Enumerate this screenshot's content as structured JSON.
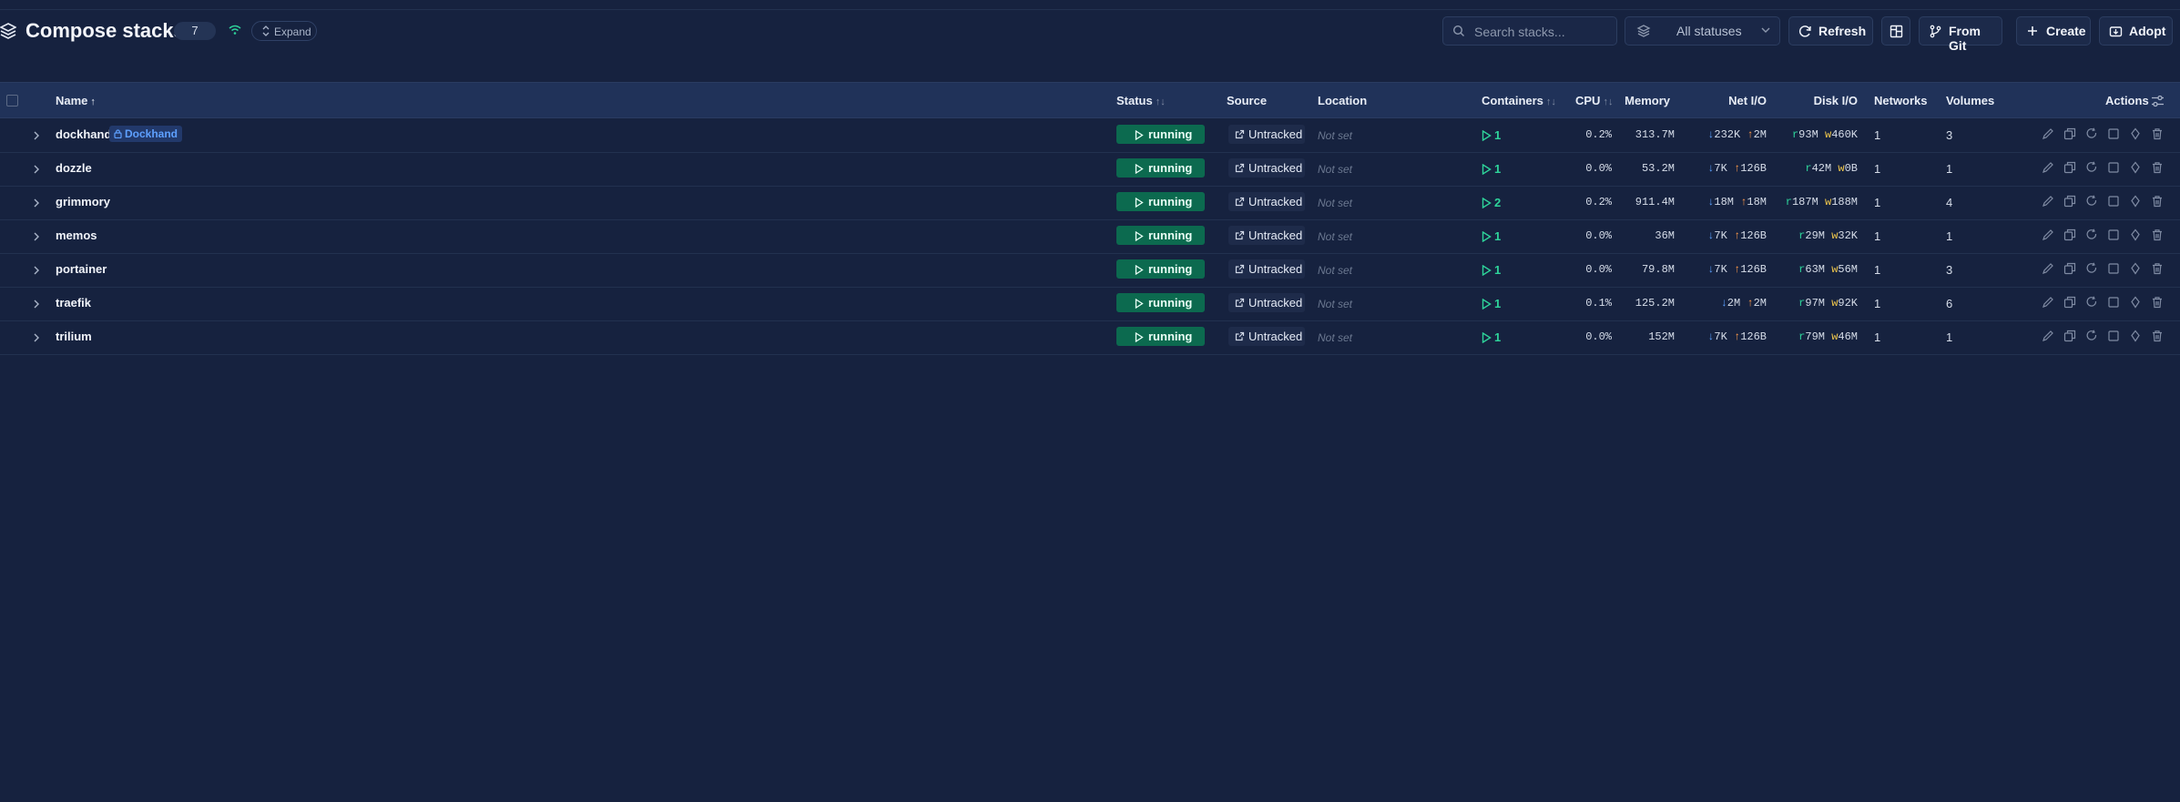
{
  "header": {
    "title": "Compose stacks",
    "count": "7",
    "expand_label": "Expand",
    "search_placeholder": "Search stacks...",
    "status_filter": "All statuses",
    "refresh_label": "Refresh",
    "from_git_label": "From Git",
    "create_label": "Create",
    "adopt_label": "Adopt"
  },
  "table": {
    "columns": {
      "name": "Name",
      "status": "Status",
      "source": "Source",
      "location": "Location",
      "containers": "Containers",
      "cpu": "CPU",
      "memory": "Memory",
      "net_io": "Net I/O",
      "disk_io": "Disk I/O",
      "networks": "Networks",
      "volumes": "Volumes",
      "actions": "Actions"
    },
    "rows": [
      {
        "name": "dockhand",
        "tag": "Dockhand",
        "status": "running",
        "source": "Untracked",
        "location": "Not set",
        "containers": "1",
        "cpu": "0.2%",
        "memory": "313.7M",
        "net_down": "232K",
        "net_up": "2M",
        "disk_read": "93M",
        "disk_write": "460K",
        "networks": "1",
        "volumes": "3"
      },
      {
        "name": "dozzle",
        "status": "running",
        "source": "Untracked",
        "location": "Not set",
        "containers": "1",
        "cpu": "0.0%",
        "memory": "53.2M",
        "net_down": "7K",
        "net_up": "126B",
        "disk_read": "42M",
        "disk_write": "0B",
        "networks": "1",
        "volumes": "1"
      },
      {
        "name": "grimmory",
        "status": "running",
        "source": "Untracked",
        "location": "Not set",
        "containers": "2",
        "cpu": "0.2%",
        "memory": "911.4M",
        "net_down": "18M",
        "net_up": "18M",
        "disk_read": "187M",
        "disk_write": "188M",
        "networks": "1",
        "volumes": "4"
      },
      {
        "name": "memos",
        "status": "running",
        "source": "Untracked",
        "location": "Not set",
        "containers": "1",
        "cpu": "0.0%",
        "memory": "36M",
        "net_down": "7K",
        "net_up": "126B",
        "disk_read": "29M",
        "disk_write": "32K",
        "networks": "1",
        "volumes": "1"
      },
      {
        "name": "portainer",
        "status": "running",
        "source": "Untracked",
        "location": "Not set",
        "containers": "1",
        "cpu": "0.0%",
        "memory": "79.8M",
        "net_down": "7K",
        "net_up": "126B",
        "disk_read": "63M",
        "disk_write": "56M",
        "networks": "1",
        "volumes": "3"
      },
      {
        "name": "traefik",
        "status": "running",
        "source": "Untracked",
        "location": "Not set",
        "containers": "1",
        "cpu": "0.1%",
        "memory": "125.2M",
        "net_down": "2M",
        "net_up": "2M",
        "disk_read": "97M",
        "disk_write": "92K",
        "networks": "1",
        "volumes": "6"
      },
      {
        "name": "trilium",
        "status": "running",
        "source": "Untracked",
        "location": "Not set",
        "containers": "1",
        "cpu": "0.0%",
        "memory": "152M",
        "net_down": "7K",
        "net_up": "126B",
        "disk_read": "79M",
        "disk_write": "46M",
        "networks": "1",
        "volumes": "1"
      }
    ]
  },
  "symbols": {
    "down": "↓",
    "up": "↑",
    "read": "r",
    "write": "w"
  },
  "colors": {
    "background": "#16223f",
    "running": "#0c6a4f",
    "accent_blue": "#5aa0ff",
    "accent_green": "#2ed39a",
    "accent_orange": "#ff9a4a",
    "accent_yellow": "#f2c94c"
  },
  "icons": [
    "layers-icon",
    "wifi-icon",
    "chevron-updown-icon",
    "search-icon",
    "layers-filter-icon",
    "chevron-down-icon",
    "refresh-icon",
    "layout-icon",
    "git-branch-icon",
    "plus-icon",
    "adopt-icon",
    "sliders-icon",
    "chevron-right-icon",
    "play-icon",
    "external-link-icon",
    "edit-icon",
    "copy-icon",
    "restart-icon",
    "stop-icon",
    "pause-icon",
    "trash-icon"
  ]
}
